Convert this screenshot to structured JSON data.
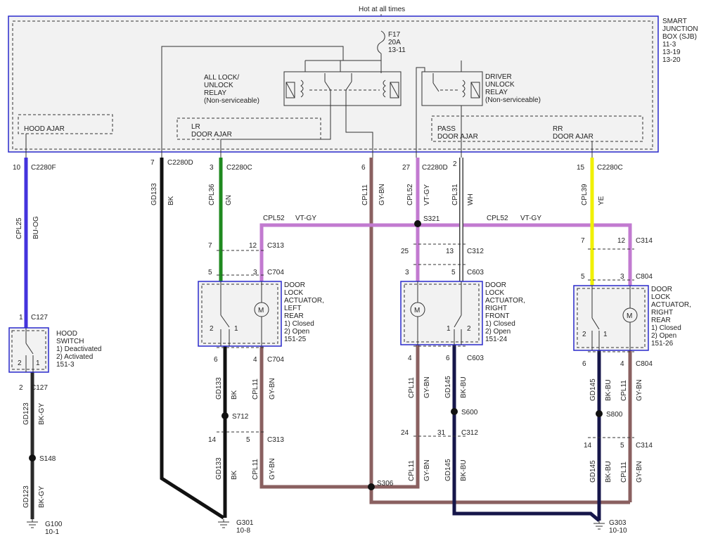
{
  "top_note": "Hot at all times",
  "sjb": {
    "title": [
      "SMART",
      "JUNCTION",
      "BOX (SJB)",
      "11-3",
      "13-19",
      "13-20"
    ]
  },
  "fuse": [
    "F17",
    "20A",
    "13-11"
  ],
  "relays": {
    "all_lock": [
      "ALL LOCK/",
      "UNLOCK",
      "RELAY",
      "(Non-serviceable)"
    ],
    "driver_unlock": [
      "DRIVER",
      "UNLOCK",
      "RELAY",
      "(Non-serviceable)"
    ]
  },
  "sections": {
    "hood_ajar": "HOOD AJAR",
    "lr_door_ajar": [
      "LR",
      "DOOR AJAR"
    ],
    "pass_door_ajar": [
      "PASS",
      "DOOR AJAR"
    ],
    "rr_door_ajar": [
      "RR",
      "DOOR AJAR"
    ]
  },
  "pins": {
    "c2280f": {
      "pin": "10",
      "conn": "C2280F"
    },
    "c2280d_bk": {
      "pin": "7",
      "conn": "C2280D"
    },
    "c2280c_gn": {
      "pin": "3",
      "conn": "C2280C"
    },
    "gybn_pin": "6",
    "c2280d_vt": {
      "pin": "27",
      "conn": "C2280D"
    },
    "wh_pin": "2",
    "c2280c_ye": {
      "pin": "15",
      "conn": "C2280C"
    }
  },
  "wires": {
    "cpl25": {
      "circuit": "CPL25",
      "color": "BU-OG"
    },
    "gd133_top": {
      "circuit": "GD133",
      "color": "BK"
    },
    "cpl36": {
      "circuit": "CPL36",
      "color": "GN"
    },
    "cpl11_main": {
      "circuit": "CPL11",
      "color": "GY-BN"
    },
    "cpl52_drop": {
      "circuit": "CPL52",
      "color": "VT-GY"
    },
    "cpl31": {
      "circuit": "CPL31",
      "color": "WH"
    },
    "cpl39": {
      "circuit": "CPL39",
      "color": "YE"
    },
    "cpl52_bus_left": {
      "circuit": "CPL52",
      "color": "VT-GY"
    },
    "cpl52_bus_right": {
      "circuit": "CPL52",
      "color": "VT-GY"
    },
    "gd123_a": {
      "circuit": "GD123",
      "color": "BK-GY"
    },
    "gd123_b": {
      "circuit": "GD123",
      "color": "BK-GY"
    },
    "gd133_lr_a": {
      "circuit": "GD133",
      "color": "BK"
    },
    "gd133_lr_b": {
      "circuit": "GD133",
      "color": "BK"
    },
    "cpl11_lr_a": {
      "circuit": "CPL11",
      "color": "GY-BN"
    },
    "cpl11_lr_b": {
      "circuit": "CPL11",
      "color": "GY-BN"
    },
    "cpl11_rf_a": {
      "circuit": "CPL11",
      "color": "GY-BN"
    },
    "cpl11_rf_b": {
      "circuit": "CPL11",
      "color": "GY-BN"
    },
    "gd145_rf_a": {
      "circuit": "GD145",
      "color": "BK-BU"
    },
    "gd145_rf_b": {
      "circuit": "GD145",
      "color": "BK-BU"
    },
    "gd145_rr_a": {
      "circuit": "GD145",
      "color": "BK-BU"
    },
    "gd145_rr_b": {
      "circuit": "GD145",
      "color": "BK-BU"
    },
    "cpl11_rr_a": {
      "circuit": "CPL11",
      "color": "GY-BN"
    },
    "cpl11_rr_b": {
      "circuit": "CPL11",
      "color": "GY-BN"
    }
  },
  "splices": {
    "s321": "S321",
    "s148": "S148",
    "s712": "S712",
    "s600": "S600",
    "s800": "S800",
    "s306": "S306"
  },
  "connectors": {
    "c313_top": {
      "pins": [
        "7",
        "12"
      ],
      "conn": "C313"
    },
    "c704_top": {
      "pins": [
        "5",
        "3"
      ],
      "conn": "C704"
    },
    "c312_top": {
      "pins": [
        "25",
        "13"
      ],
      "conn": "C312"
    },
    "c603_top": {
      "pins": [
        "3",
        "5"
      ],
      "conn": "C603"
    },
    "c314_top": {
      "pins": [
        "7",
        "12"
      ],
      "conn": "C314"
    },
    "c804_top": {
      "pins": [
        "5",
        "3"
      ],
      "conn": "C804"
    },
    "c127_top": {
      "pin": "1",
      "conn": "C127"
    },
    "c127_bot": {
      "pin": "2",
      "conn": "C127"
    },
    "lr_bot": {
      "pins": [
        "6",
        "4"
      ],
      "conn": "C704"
    },
    "rf_bot": {
      "pins": [
        "4",
        "6"
      ],
      "conn": "C603"
    },
    "rr_bot": {
      "pins": [
        "6",
        "4"
      ],
      "conn": "C804"
    },
    "c313_bot": {
      "pins": [
        "14",
        "5"
      ],
      "conn": "C313"
    },
    "c312_bot": {
      "pins": [
        "24",
        "31"
      ],
      "conn": "C312"
    },
    "c314_bot": {
      "pins": [
        "14",
        "5"
      ],
      "conn": "C314"
    }
  },
  "components": {
    "hood_switch": {
      "lines": [
        "HOOD",
        "SWITCH",
        "1) Deactivated",
        "2) Activated",
        "151-3"
      ],
      "pins": [
        "2",
        "1"
      ]
    },
    "lr_actuator": {
      "lines": [
        "DOOR",
        "LOCK",
        "ACTUATOR,",
        "LEFT",
        "REAR",
        "1) Closed",
        "2) Open",
        "151-25"
      ],
      "pins": [
        "2",
        "1"
      ],
      "motor": "M"
    },
    "rf_actuator": {
      "lines": [
        "DOOR",
        "LOCK",
        "ACTUATOR,",
        "RIGHT",
        "FRONT",
        "1) Closed",
        "2) Open",
        "151-24"
      ],
      "pins": [
        "1",
        "2"
      ],
      "motor": "M"
    },
    "rr_actuator": {
      "lines": [
        "DOOR",
        "LOCK",
        "ACTUATOR,",
        "RIGHT",
        "REAR",
        "1) Closed",
        "2) Open",
        "151-26"
      ],
      "pins": [
        "2",
        "1"
      ],
      "motor": "M"
    }
  },
  "grounds": {
    "g100": [
      "G100",
      "10-1"
    ],
    "g301": [
      "G301",
      "10-8"
    ],
    "g303": [
      "G303",
      "10-10"
    ]
  },
  "colors": {
    "box_border": "#2a2acc",
    "bu_og": "#4433dd",
    "bk": "#111111",
    "gn": "#1f8a1f",
    "gy_bn": "#8a6060",
    "vt_gy": "#c27ad0",
    "wh": "#ffffff",
    "ye": "#f0f000",
    "bk_bu": "#16164a",
    "bk_gy": "#2a2a2a"
  }
}
